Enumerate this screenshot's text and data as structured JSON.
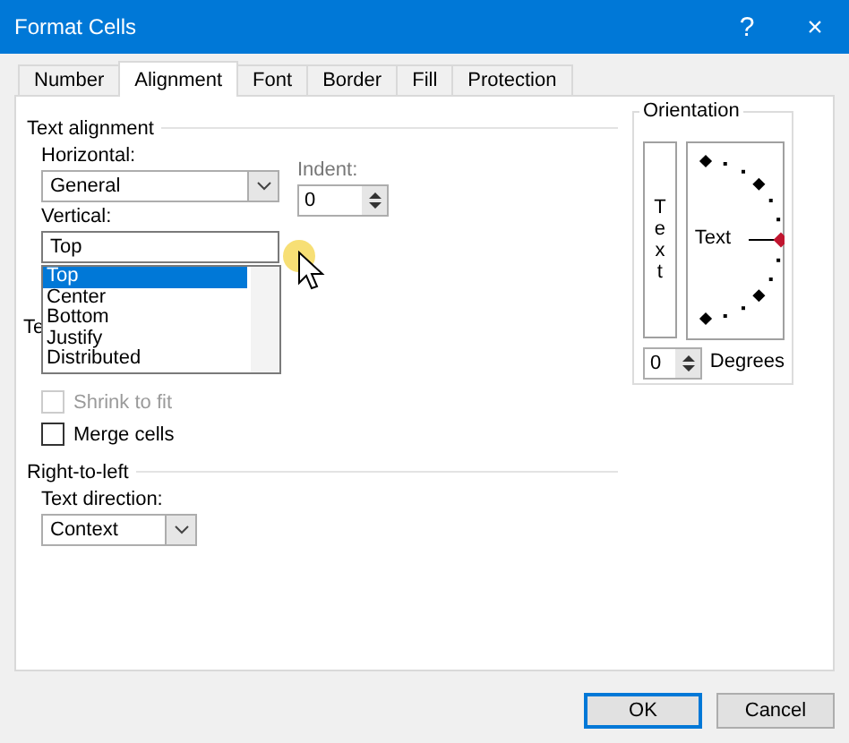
{
  "window": {
    "title": "Format Cells",
    "help": "?",
    "close": "×"
  },
  "tabs": [
    {
      "label": "Number",
      "selected": false
    },
    {
      "label": "Alignment",
      "selected": true
    },
    {
      "label": "Font",
      "selected": false
    },
    {
      "label": "Border",
      "selected": false
    },
    {
      "label": "Fill",
      "selected": false
    },
    {
      "label": "Protection",
      "selected": false
    }
  ],
  "text_alignment": {
    "title": "Text alignment",
    "horizontal": {
      "label": "Horizontal:",
      "value": "General"
    },
    "indent": {
      "label": "Indent:",
      "value": "0"
    },
    "vertical": {
      "label": "Vertical:",
      "value": "Top",
      "options": [
        {
          "label": "Top",
          "selected": true
        },
        {
          "label": "Center",
          "selected": false
        },
        {
          "label": "Bottom",
          "selected": false
        },
        {
          "label": "Justify",
          "selected": false
        },
        {
          "label": "Distributed",
          "selected": false
        }
      ]
    }
  },
  "text_control": {
    "title": "Te",
    "checkboxes": [
      {
        "label": "Shrink to fit",
        "checked": false,
        "disabled": true
      },
      {
        "label": "Merge cells",
        "checked": false,
        "disabled": false
      }
    ]
  },
  "right_to_left": {
    "title": "Right-to-left",
    "text_direction": {
      "label": "Text direction:",
      "value": "Context"
    }
  },
  "orientation": {
    "title": "Orientation",
    "vertical_text": "Text",
    "dial_text": "Text",
    "degrees": {
      "value": "0",
      "label": "Degrees"
    }
  },
  "buttons": [
    {
      "label": "OK",
      "default": true
    },
    {
      "label": "Cancel",
      "default": false
    }
  ]
}
